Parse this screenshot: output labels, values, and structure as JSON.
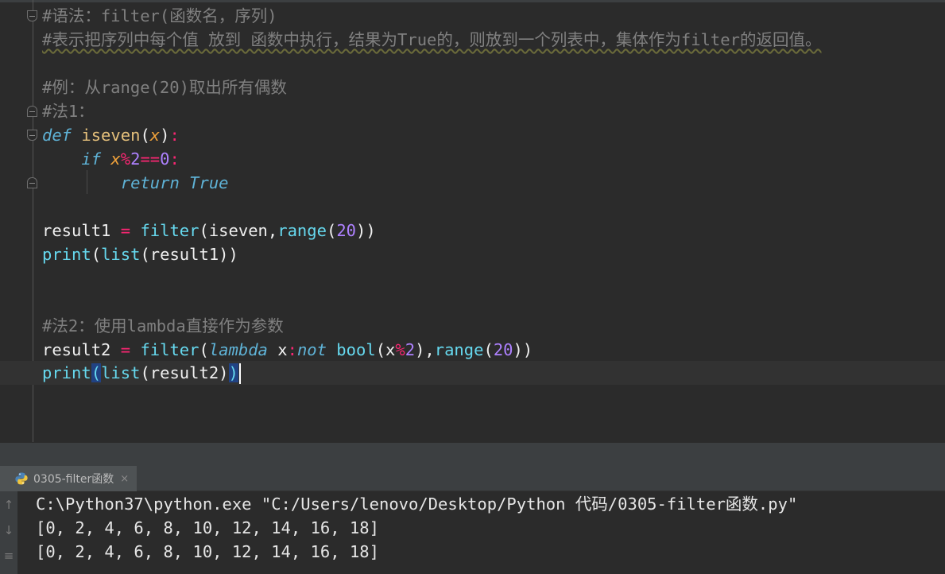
{
  "editor": {
    "lines": {
      "l1": {
        "comment": "#语法：filter(函数名，序列)"
      },
      "l2": {
        "comment": "#表示把序列中每个值 放到 函数中执行，结果为True的，则放到一个列表中，集体作为filter的返回值。"
      },
      "l4": {
        "comment": "#例：从range(20)取出所有偶数"
      },
      "l5": {
        "comment": "#法1："
      },
      "l6": {
        "kw_def": "def",
        "fname": "iseven",
        "lp": "(",
        "param": "x",
        "rp": ")",
        "colon": ":"
      },
      "l7": {
        "kw_if": "if",
        "var": "x",
        "mod": "%",
        "two": "2",
        "eq": "==",
        "zero": "0",
        "colon": ":"
      },
      "l8": {
        "kw_return": "return",
        "true_kw": "True"
      },
      "l10": {
        "var": "result1",
        "assign": " = ",
        "fn": "filter",
        "args_a": "(iseven,",
        "fn2": "range",
        "lp": "(",
        "n": "20",
        "rp": "))"
      },
      "l11": {
        "fn": "print",
        "lp": "(",
        "fn2": "list",
        "rest": "(result1))"
      },
      "l14": {
        "comment": "#法2：使用lambda直接作为参数"
      },
      "l15": {
        "var": "result2",
        "assign": " = ",
        "fn": "filter",
        "lp": "(",
        "kw_lambda": "lambda",
        "x": " x",
        "colon": ":",
        "kw_not": "not",
        "fn_bool": " bool",
        "lp2": "(x",
        "mod": "%",
        "two": "2",
        "rp2": "),",
        "fn_range": "range",
        "lp3": "(",
        "n": "20",
        "rp3": "))"
      },
      "l16": {
        "fn": "print",
        "lp": "(",
        "fn2": "list",
        "mid": "(result2)",
        "rp": ")"
      }
    }
  },
  "run_panel": {
    "tab_label": "0305-filter函数",
    "close_glyph": "×",
    "toolbar": {
      "up": "↑",
      "down": "↓",
      "wrap": "≡"
    },
    "console_lines": [
      "C:\\Python37\\python.exe \"C:/Users/lenovo/Desktop/Python 代码/0305-filter函数.py\"",
      "[0, 2, 4, 6, 8, 10, 12, 14, 16, 18]",
      "[0, 2, 4, 6, 8, 10, 12, 14, 16, 18]"
    ]
  },
  "colors": {
    "background": "#2b2b2b",
    "comment": "#808080",
    "keyword": "#5fb3d7",
    "function": "#e5c07b",
    "parameter": "#f0a23b",
    "operator": "#f92672",
    "number": "#ae81ff",
    "builtin": "#66d9ef",
    "selection": "#214283"
  }
}
